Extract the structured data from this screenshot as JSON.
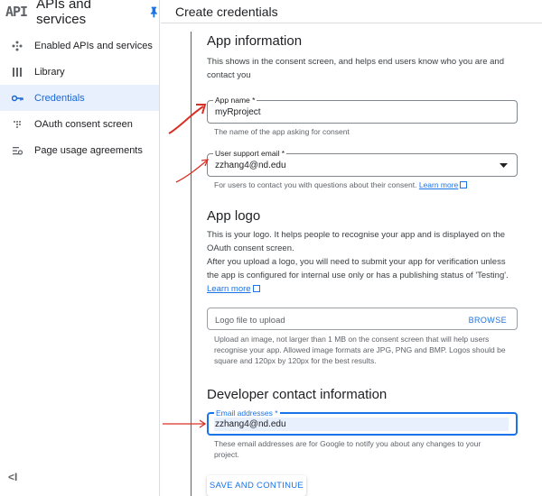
{
  "sidebar": {
    "logo": "API",
    "title": "APIs and services",
    "items": [
      {
        "label": "Enabled APIs and services",
        "icon": "enabled-apis-icon"
      },
      {
        "label": "Library",
        "icon": "library-icon"
      },
      {
        "label": "Credentials",
        "icon": "key-icon",
        "active": true
      },
      {
        "label": "OAuth consent screen",
        "icon": "oauth-icon"
      },
      {
        "label": "Page usage agreements",
        "icon": "settings-list-icon"
      }
    ],
    "collapse": "<I"
  },
  "topbar": {
    "title": "Create credentials"
  },
  "app_info": {
    "heading": "App information",
    "description": "This shows in the consent screen, and helps end users know who you are and contact you",
    "app_name_label": "App name *",
    "app_name_value": "myRproject",
    "app_name_helper": "The name of the app asking for consent",
    "support_email_label": "User support email *",
    "support_email_value": "zzhang4@nd.edu",
    "support_email_helper": "For users to contact you with questions about their consent.",
    "learn_more": "Learn more"
  },
  "app_logo": {
    "heading": "App logo",
    "para1": "This is your logo. It helps people to recognise your app and is displayed on the OAuth consent screen.",
    "para2": "After you upload a logo, you will need to submit your app for verification unless the app is configured for internal use only or has a publishing status of 'Testing'.",
    "learn_more": "Learn more",
    "file_placeholder": "Logo file to upload",
    "browse": "BROWSE",
    "helper": "Upload an image, not larger than 1 MB on the consent screen that will help users recognise your app. Allowed image formats are JPG, PNG and BMP. Logos should be square and 120px by 120px for the best results."
  },
  "developer": {
    "heading": "Developer contact information",
    "email_label": "Email addresses *",
    "email_value": "zzhang4@nd.edu",
    "helper": "These email addresses are for Google to notify you about any changes to your project."
  },
  "save_button": "SAVE AND CONTINUE",
  "colors": {
    "accent": "#1a73e8",
    "active_bg": "#e8f0fe",
    "annotation": "#d93025"
  }
}
